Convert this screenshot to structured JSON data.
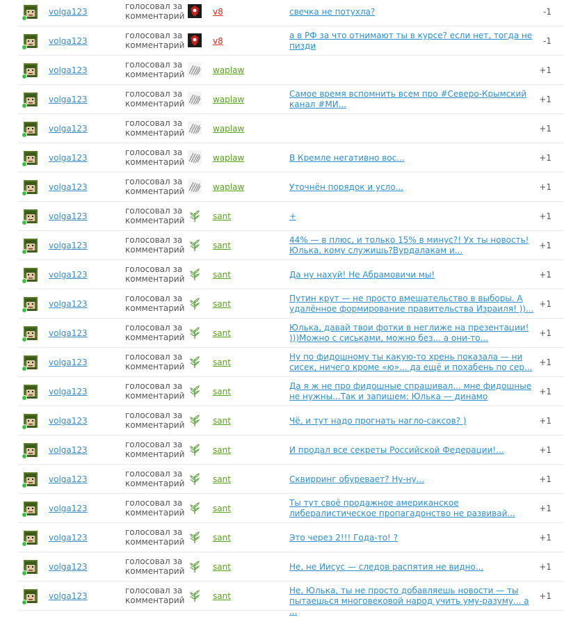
{
  "votes": [
    {
      "user": "volga123",
      "action": "голосовал за комментарий",
      "target": "v8",
      "target_color": "red",
      "target_icon": "v8-avatar-icon",
      "comment": "свечка не потухла?",
      "score": "-1"
    },
    {
      "user": "volga123",
      "action": "голосовал за комментарий",
      "target": "v8",
      "target_color": "red",
      "target_icon": "v8-avatar-icon",
      "comment": "а в РФ за что отнимают ты в курсе? если нет, тогда не пизди",
      "score": "-1"
    },
    {
      "user": "volga123",
      "action": "голосовал за комментарий",
      "target": "waplaw",
      "target_color": "green",
      "target_icon": "waplaw-avatar-icon",
      "comment": "",
      "score": "+1"
    },
    {
      "user": "volga123",
      "action": "голосовал за комментарий",
      "target": "waplaw",
      "target_color": "green",
      "target_icon": "waplaw-avatar-icon",
      "comment": "Самое время вспомнить всем про #Северо-Крымский канал #МИ...",
      "score": "+1"
    },
    {
      "user": "volga123",
      "action": "голосовал за комментарий",
      "target": "waplaw",
      "target_color": "green",
      "target_icon": "waplaw-avatar-icon",
      "comment": "",
      "score": "+1"
    },
    {
      "user": "volga123",
      "action": "голосовал за комментарий",
      "target": "waplaw",
      "target_color": "green",
      "target_icon": "waplaw-avatar-icon",
      "comment": "В Кремле негативно вос...",
      "score": "+1"
    },
    {
      "user": "volga123",
      "action": "голосовал за комментарий",
      "target": "waplaw",
      "target_color": "green",
      "target_icon": "waplaw-avatar-icon",
      "comment": "Уточнён порядок и усло...",
      "score": "+1"
    },
    {
      "user": "volga123",
      "action": "голосовал за комментарий",
      "target": "sant",
      "target_color": "green",
      "target_icon": "sant-tree-icon",
      "comment": "+",
      "score": "+1"
    },
    {
      "user": "volga123",
      "action": "голосовал за комментарий",
      "target": "sant",
      "target_color": "green",
      "target_icon": "sant-tree-icon",
      "comment": "44% — в плюс, и только 15% в минус?! Ух ты новость! Юлька, кому служишь?Вурдалакам и...",
      "score": "+1"
    },
    {
      "user": "volga123",
      "action": "голосовал за комментарий",
      "target": "sant",
      "target_color": "green",
      "target_icon": "sant-tree-icon",
      "comment": "Да ну нахуй! Не Абрамовичи мы!",
      "score": "+1"
    },
    {
      "user": "volga123",
      "action": "голосовал за комментарий",
      "target": "sant",
      "target_color": "green",
      "target_icon": "sant-tree-icon",
      "comment": "Путин крут — не просто вмешательство в выборы. А удалённое формирование правительства Израиля! ))...",
      "score": "+1"
    },
    {
      "user": "volga123",
      "action": "голосовал за комментарий",
      "target": "sant",
      "target_color": "green",
      "target_icon": "sant-tree-icon",
      "comment": "Юлька, давай твои фотки в неглиже на презентации! )))Можно с сиськами, можно без... а они-то...",
      "score": "+1"
    },
    {
      "user": "volga123",
      "action": "голосовал за комментарий",
      "target": "sant",
      "target_color": "green",
      "target_icon": "sant-tree-icon",
      "comment": "Ну по фидошному ты какую-то хрень показала — ни сисек, ничего кроме «ю»... да ещё и похабень по сер...",
      "score": "+1"
    },
    {
      "user": "volga123",
      "action": "голосовал за комментарий",
      "target": "sant",
      "target_color": "green",
      "target_icon": "sant-tree-icon",
      "comment": "Да я ж не про фидошные спрашивал... мне фидошные не нужны...Так и запишем: Юлька — динамо",
      "score": "+1"
    },
    {
      "user": "volga123",
      "action": "голосовал за комментарий",
      "target": "sant",
      "target_color": "green",
      "target_icon": "sant-tree-icon",
      "comment": "Чё, и тут надо прогнать нагло-саксов? )",
      "score": "+1"
    },
    {
      "user": "volga123",
      "action": "голосовал за комментарий",
      "target": "sant",
      "target_color": "green",
      "target_icon": "sant-tree-icon",
      "comment": "И продал все секреты Российской Федерации!...",
      "score": "+1"
    },
    {
      "user": "volga123",
      "action": "голосовал за комментарий",
      "target": "sant",
      "target_color": "green",
      "target_icon": "sant-tree-icon",
      "comment": "Сквирринг обуревает? Ну-ну...",
      "score": "+1"
    },
    {
      "user": "volga123",
      "action": "голосовал за комментарий",
      "target": "sant",
      "target_color": "green",
      "target_icon": "sant-tree-icon",
      "comment": "Ты тут своё продажное американское либералистическое пропагадонство не развивай...",
      "score": "+1"
    },
    {
      "user": "volga123",
      "action": "голосовал за комментарий",
      "target": "sant",
      "target_color": "green",
      "target_icon": "sant-tree-icon",
      "comment": "Это через 2!!! Года-то! ?",
      "score": "+1"
    },
    {
      "user": "volga123",
      "action": "голосовал за комментарий",
      "target": "sant",
      "target_color": "green",
      "target_icon": "sant-tree-icon",
      "comment": "Не, не Иисус — следов распятия не видно...",
      "score": "+1"
    },
    {
      "user": "volga123",
      "action": "голосовал за комментарий",
      "target": "sant",
      "target_color": "green",
      "target_icon": "sant-tree-icon",
      "comment": "Не, Юлька, ты не просто добавляешь новости — ты пытаешься многовековой народ учить уму-разуму... а ...",
      "score": "+1"
    }
  ],
  "colors": {
    "link": "#3b8bc4",
    "comment_link": "#2e8fd0",
    "red_user": "#d8261a",
    "green_user": "#55a413",
    "online": "#3fbf3f"
  }
}
